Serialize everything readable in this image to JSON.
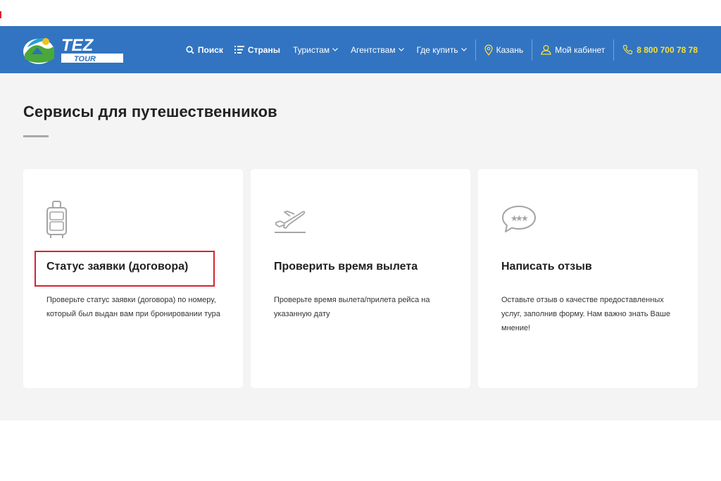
{
  "header": {
    "logo_text": "TEZ",
    "logo_subtext": "TOUR",
    "nav": {
      "search": "Поиск",
      "countries": "Страны",
      "tourists": "Туристам",
      "agencies": "Агентствам",
      "where_to_buy": "Где купить",
      "city": "Казань",
      "cabinet": "Мой кабинет",
      "phone": "8 800 700 78 78"
    }
  },
  "main": {
    "title": "Сервисы для путешественников",
    "cards": [
      {
        "title": "Статус заявки (договора)",
        "description": "Проверьте статус заявки (договора) по номеру, который был выдан вам при бронировании тура",
        "icon": "suitcase-icon"
      },
      {
        "title": "Проверить время вылета",
        "description": "Проверьте время вылета/прилета рейса на указанную дату",
        "icon": "plane-departure-icon"
      },
      {
        "title": "Написать отзыв",
        "description": "Оставьте отзыв о качестве предоставленных услуг, заполнив форму. Нам важно знать Ваше мнение!",
        "icon": "review-bubble-icon"
      }
    ]
  },
  "colors": {
    "header_bg": "#3274c1",
    "phone": "#f5e03a",
    "page_bg": "#f4f4f4",
    "highlight": "#d8232f"
  }
}
